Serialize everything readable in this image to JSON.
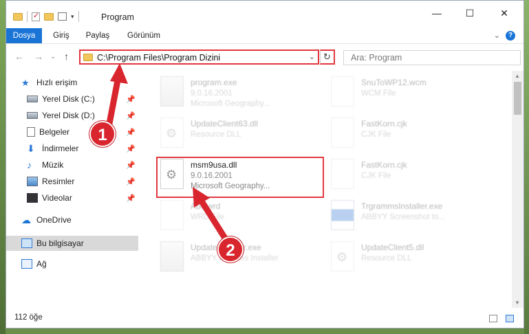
{
  "window": {
    "title": "Program",
    "minimize": "—",
    "maximize": "☐",
    "close": "✕"
  },
  "ribbon": {
    "tabs": [
      "Dosya",
      "Giriş",
      "Paylaş",
      "Görünüm"
    ],
    "help": "?",
    "collapse": "⌄"
  },
  "nav": {
    "back": "←",
    "forward": "→",
    "history": "⌄",
    "up": "↑",
    "address": "C:\\Program Files\\Program Dizini",
    "address_chevron": "⌄",
    "refresh": "↻",
    "search_placeholder": "Ara: Program"
  },
  "sidebar": {
    "items": [
      {
        "label": "Hızlı erişim",
        "icon": "star-icon",
        "pinned": false
      },
      {
        "label": "Yerel Disk (C:)",
        "icon": "disk-icon",
        "pinned": true
      },
      {
        "label": "Yerel Disk (D:)",
        "icon": "disk-icon",
        "pinned": true
      },
      {
        "label": "Belgeler",
        "icon": "document-icon",
        "pinned": true
      },
      {
        "label": "İndirmeler",
        "icon": "download-icon",
        "pinned": true
      },
      {
        "label": "Müzik",
        "icon": "music-icon",
        "pinned": true
      },
      {
        "label": "Resimler",
        "icon": "pictures-icon",
        "pinned": true
      },
      {
        "label": "Videolar",
        "icon": "videos-icon",
        "pinned": true
      },
      {
        "label": "OneDrive",
        "icon": "cloud-icon",
        "pinned": false
      },
      {
        "label": "Bu bilgisayar",
        "icon": "computer-icon",
        "pinned": false,
        "selected": true
      },
      {
        "label": "Ağ",
        "icon": "network-icon",
        "pinned": false
      }
    ],
    "pin_glyph": "📌"
  },
  "files": [
    {
      "name": "program.exe",
      "line2": "9.0.16.2001",
      "line3": "Microsoft Geography...",
      "type": "exe"
    },
    {
      "name": "SnuToWP12.wcm",
      "line2": "WCM File",
      "line3": "",
      "type": "doc"
    },
    {
      "name": "UpdateClient63.dll",
      "line2": "Resource DLL",
      "line3": "",
      "type": "dll"
    },
    {
      "name": "FastKorn.cjk",
      "line2": "CJK File",
      "line3": "",
      "type": "doc"
    },
    {
      "name": "msm9usa.dll",
      "line2": "9.0.16.2001",
      "line3": "Microsoft Geography...",
      "type": "dll",
      "highlighted": true
    },
    {
      "name": "FastKorn.cjk",
      "line2": "CJK File",
      "line3": "",
      "type": "doc"
    },
    {
      "name": "Abc.wrd",
      "line2": "WRD File",
      "line3": "",
      "type": "doc"
    },
    {
      "name": "TrgrammsInstaller.exe",
      "line2": "ABBYY Screenshot to...",
      "line3": "",
      "type": "blue"
    },
    {
      "name": "UpdateInstaller.exe",
      "line2": "ABBYY Updates Installer",
      "line3": "",
      "type": "exe"
    },
    {
      "name": "UpdateClient5.dll",
      "line2": "Resource DLL",
      "line3": "",
      "type": "dll"
    }
  ],
  "callouts": [
    "1",
    "2"
  ],
  "status": {
    "count": "112 öğe"
  },
  "colors": {
    "accent": "#1a74d6",
    "highlight": "#e2373f",
    "badge": "#d9262e"
  }
}
